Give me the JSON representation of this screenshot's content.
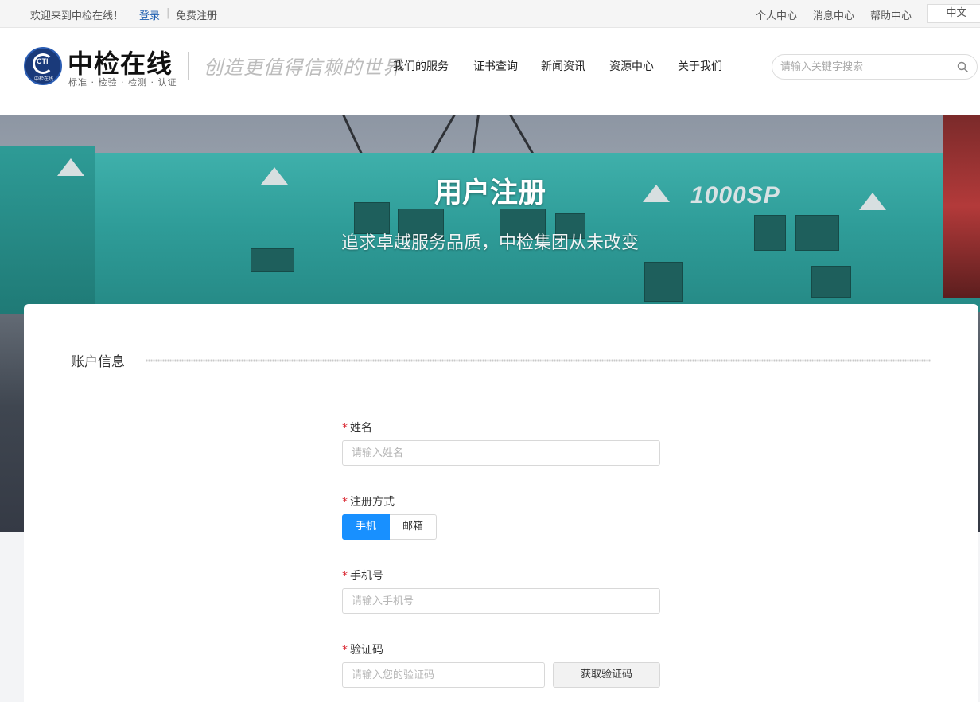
{
  "topbar": {
    "welcome": "欢迎来到中检在线！",
    "login": "登录",
    "separator": "|",
    "register": "免费注册",
    "links": [
      "个人中心",
      "消息中心",
      "帮助中心"
    ],
    "language": "中文"
  },
  "header": {
    "logo_mark": "CTI",
    "logo_mini": "中检在线",
    "brand": "中检在线",
    "tagline": "标准 · 检验 · 检测 · 认证",
    "slogan": "创造更值得信赖的世界",
    "nav": [
      "我们的服务",
      "证书查询",
      "新闻资讯",
      "资源中心",
      "关于我们"
    ],
    "search_placeholder": "请输入关键字搜索"
  },
  "banner": {
    "title": "用户注册",
    "subtitle": "追求卓越服务品质，中检集团从未改变",
    "model_text": "1000SP"
  },
  "form": {
    "section_title": "账户信息",
    "required_mark": "*",
    "name_label": "姓名",
    "name_placeholder": "请输入姓名",
    "method_label": "注册方式",
    "method_options": [
      "手机",
      "邮箱"
    ],
    "method_selected": "手机",
    "phone_label": "手机号",
    "phone_placeholder": "请输入手机号",
    "code_label": "验证码",
    "code_placeholder": "请输入您的验证码",
    "code_button": "获取验证码"
  },
  "colors": {
    "accent": "#1890ff",
    "link": "#1e5fb0",
    "required": "#d9232d",
    "logo": "#1a3a7a"
  }
}
